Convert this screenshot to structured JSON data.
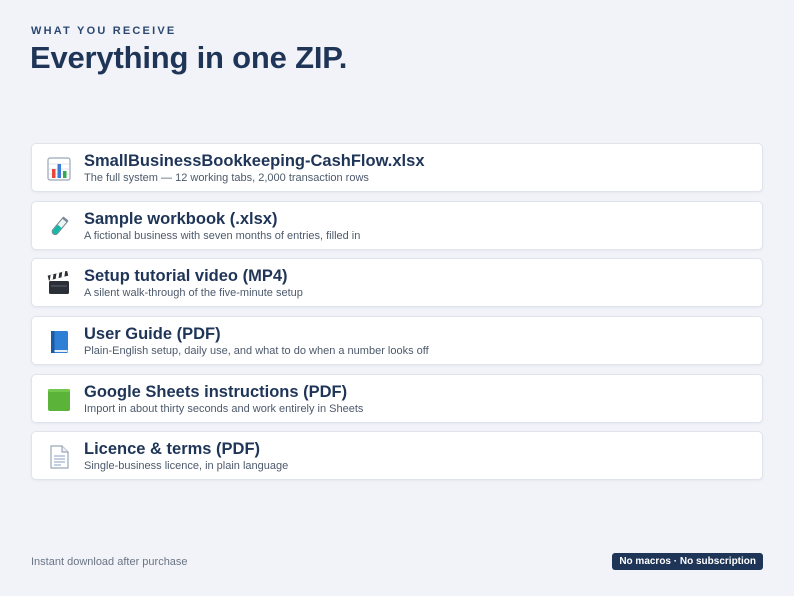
{
  "header": {
    "eyebrow": "WHAT YOU RECEIVE",
    "title": "Everything in one ZIP."
  },
  "files": [
    {
      "icon": "spreadsheet-chart-icon",
      "title": "SmallBusinessBookkeeping-CashFlow.xlsx",
      "description": "The full system — 12 working tabs, 2,000 transaction rows"
    },
    {
      "icon": "test-tube-icon",
      "title": "Sample workbook (.xlsx)",
      "description": "A fictional business with seven months of entries, filled in"
    },
    {
      "icon": "clapperboard-icon",
      "title": "Setup tutorial video (MP4)",
      "description": "A silent walk-through of the five-minute setup"
    },
    {
      "icon": "blue-book-icon",
      "title": "User Guide (PDF)",
      "description": "Plain-English setup, daily use, and what to do when a number looks off"
    },
    {
      "icon": "green-square-icon",
      "title": "Google Sheets instructions (PDF)",
      "description": "Import in about thirty seconds and work entirely in Sheets"
    },
    {
      "icon": "document-icon",
      "title": "Licence & terms (PDF)",
      "description": "Single-business licence, in plain language"
    }
  ],
  "footer": {
    "note": "Instant download after purchase",
    "badge": "No macros · No subscription"
  },
  "colors": {
    "background": "#f1f3f8",
    "navy": "#1f3558",
    "card": "#ffffff",
    "badge_bg": "#1f3558"
  }
}
